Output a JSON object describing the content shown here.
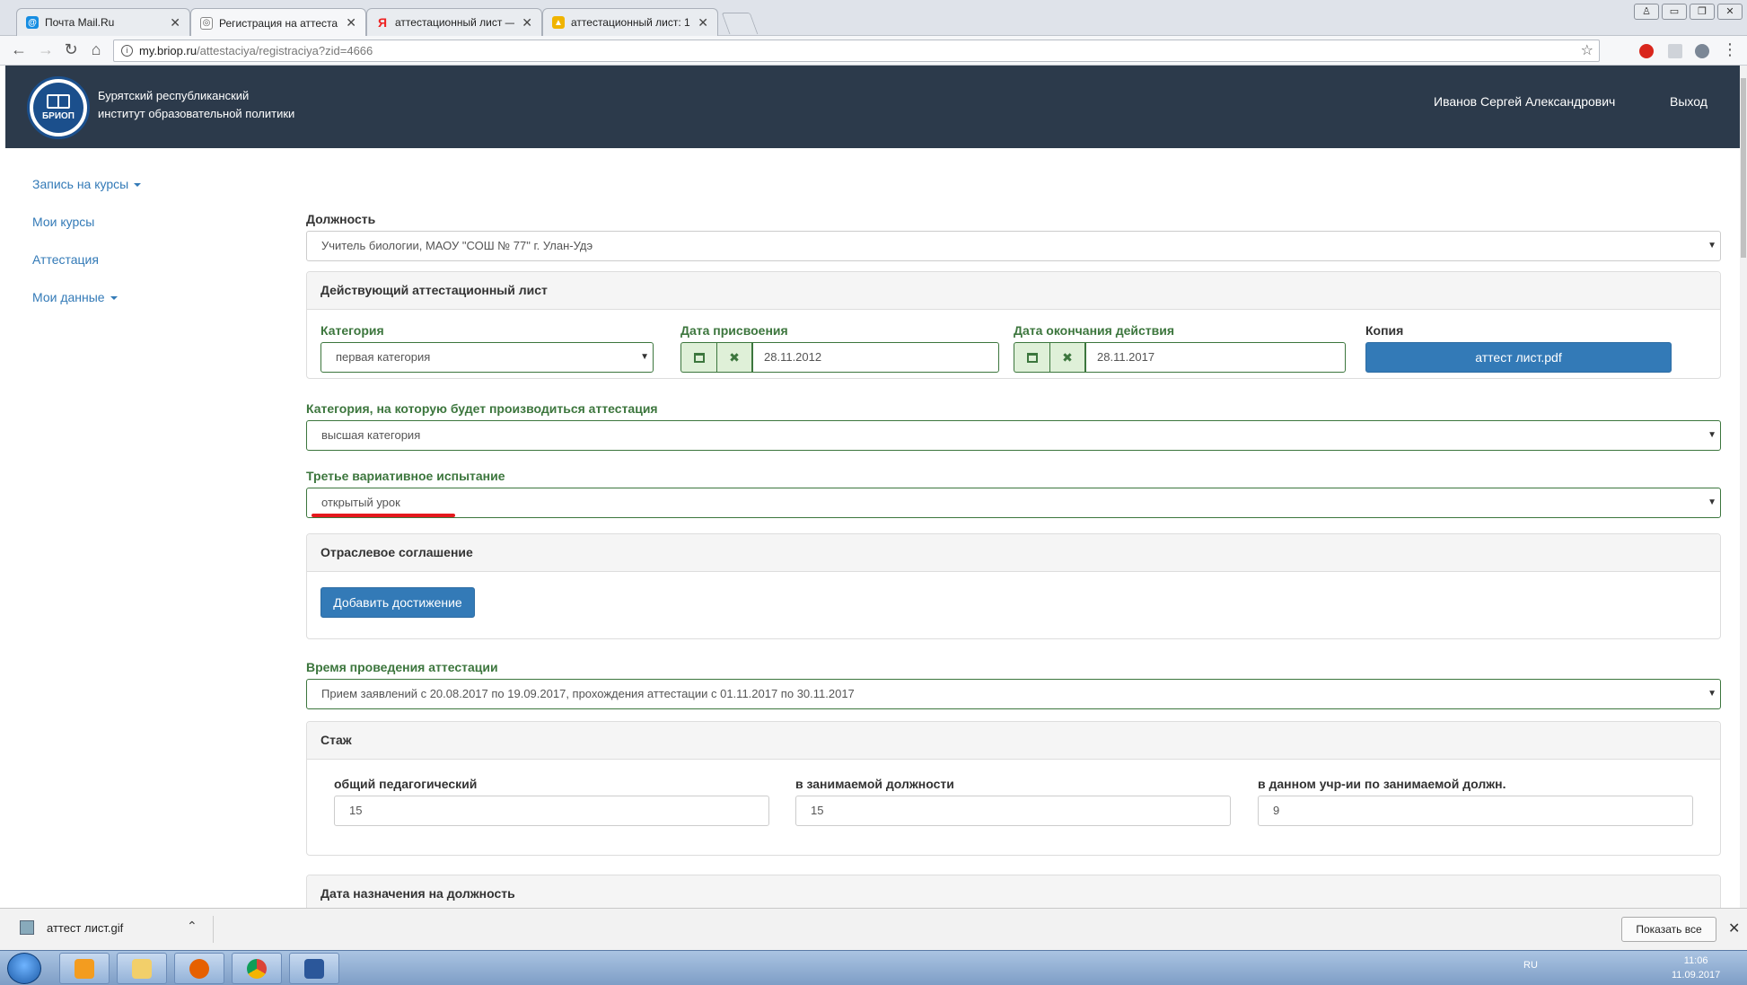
{
  "browser": {
    "tabs": [
      {
        "title": "Почта Mail.Ru"
      },
      {
        "title": "Регистрация на аттестац"
      },
      {
        "title": "аттестационный лист —"
      },
      {
        "title": "аттестационный лист: 1"
      }
    ],
    "url_host": "my.briop.ru",
    "url_path": "/attestaciya/registraciya?zid=4666"
  },
  "header": {
    "org_line1": "Бурятский республиканский",
    "org_line2": "институт образовательной политики",
    "logo_text": "БРИОП",
    "user_name": "Иванов Сергей Александрович",
    "logout": "Выход"
  },
  "sidebar": {
    "items": [
      {
        "label": "Запись на курсы"
      },
      {
        "label": "Мои курсы"
      },
      {
        "label": "Аттестация"
      },
      {
        "label": "Мои данные"
      }
    ]
  },
  "form": {
    "position_label": "Должность",
    "position_value": "Учитель биологии, МАОУ \"СОШ № 77\" г. Улан-Удэ",
    "current_panel_title": "Действующий аттестационный лист",
    "category_label": "Категория",
    "category_value": "первая категория",
    "assign_date_label": "Дата присвоения",
    "assign_date_value": "28.11.2012",
    "expiry_date_label": "Дата окончания действия",
    "expiry_date_value": "28.11.2017",
    "copy_label": "Копия",
    "copy_button": "аттест лист.pdf",
    "target_category_label": "Категория, на которую будет производиться аттестация",
    "target_category_value": "высшая категория",
    "third_test_label": "Третье вариативное испытание",
    "third_test_value": "открытый урок",
    "agreement_panel_title": "Отраслевое соглашение",
    "add_achievement_button": "Добавить достижение",
    "time_label": "Время проведения аттестации",
    "time_value": "Прием заявлений с 20.08.2017 по 19.09.2017, прохождения аттестации с 01.11.2017 по 30.11.2017",
    "experience_panel_title": "Стаж",
    "exp_total_label": "общий педагогический",
    "exp_total_value": "15",
    "exp_position_label": "в занимаемой должности",
    "exp_position_value": "15",
    "exp_institution_label": "в данном учр-ии по занимаемой должн.",
    "exp_institution_value": "9",
    "appointment_panel_title": "Дата назначения на должность"
  },
  "downloads": {
    "file_name": "аттест лист.gif",
    "show_all": "Показать все"
  },
  "taskbar": {
    "lang": "RU",
    "time": "11:06",
    "date": "11.09.2017"
  },
  "colors": {
    "header_bg": "#2c3a4b",
    "accent": "#337ab7",
    "success": "#3c763d",
    "highlight": "#e4181d"
  }
}
